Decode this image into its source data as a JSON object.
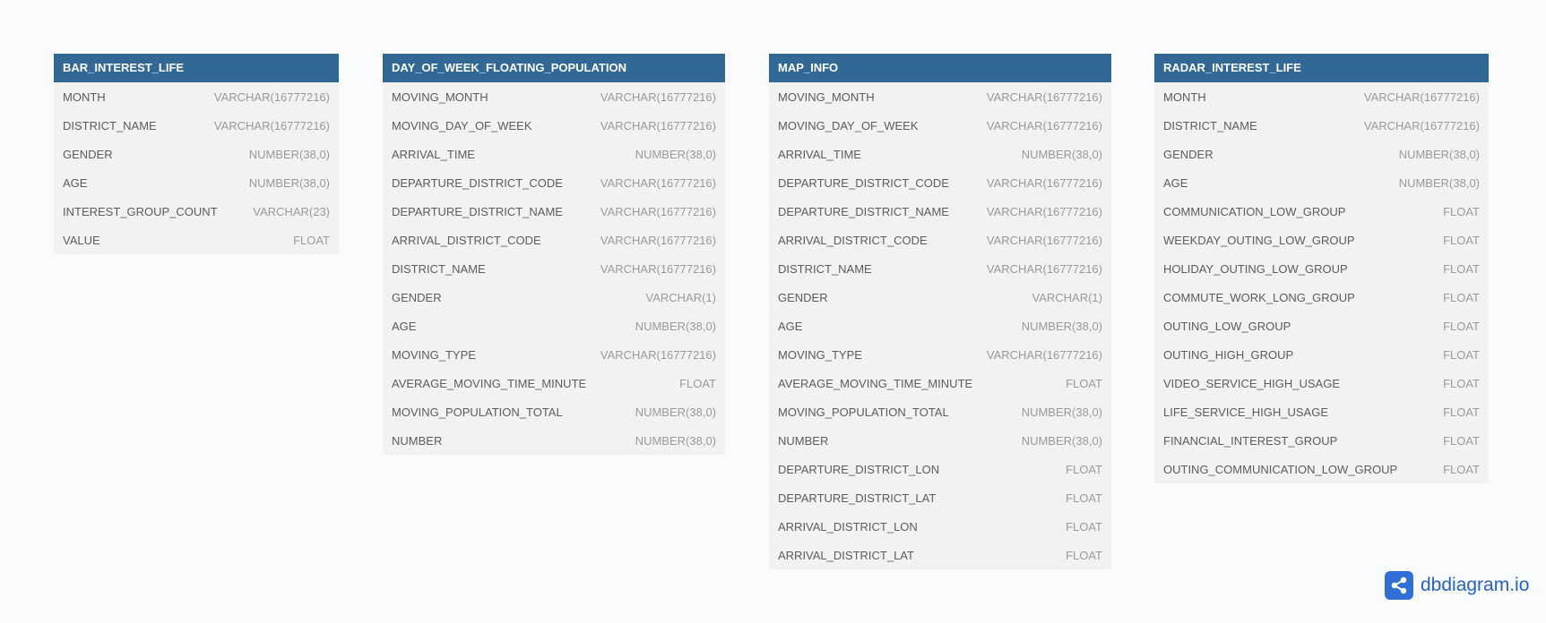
{
  "tables": [
    {
      "name": "BAR_INTEREST_LIFE",
      "fields": [
        {
          "name": "MONTH",
          "type": "VARCHAR(16777216)"
        },
        {
          "name": "DISTRICT_NAME",
          "type": "VARCHAR(16777216)"
        },
        {
          "name": "GENDER",
          "type": "NUMBER(38,0)"
        },
        {
          "name": "AGE",
          "type": "NUMBER(38,0)"
        },
        {
          "name": "INTEREST_GROUP_COUNT",
          "type": "VARCHAR(23)"
        },
        {
          "name": "VALUE",
          "type": "FLOAT"
        }
      ]
    },
    {
      "name": "DAY_OF_WEEK_FLOATING_POPULATION",
      "fields": [
        {
          "name": "MOVING_MONTH",
          "type": "VARCHAR(16777216)"
        },
        {
          "name": "MOVING_DAY_OF_WEEK",
          "type": "VARCHAR(16777216)"
        },
        {
          "name": "ARRIVAL_TIME",
          "type": "NUMBER(38,0)"
        },
        {
          "name": "DEPARTURE_DISTRICT_CODE",
          "type": "VARCHAR(16777216)"
        },
        {
          "name": "DEPARTURE_DISTRICT_NAME",
          "type": "VARCHAR(16777216)"
        },
        {
          "name": "ARRIVAL_DISTRICT_CODE",
          "type": "VARCHAR(16777216)"
        },
        {
          "name": "DISTRICT_NAME",
          "type": "VARCHAR(16777216)"
        },
        {
          "name": "GENDER",
          "type": "VARCHAR(1)"
        },
        {
          "name": "AGE",
          "type": "NUMBER(38,0)"
        },
        {
          "name": "MOVING_TYPE",
          "type": "VARCHAR(16777216)"
        },
        {
          "name": "AVERAGE_MOVING_TIME_MINUTE",
          "type": "FLOAT"
        },
        {
          "name": "MOVING_POPULATION_TOTAL",
          "type": "NUMBER(38,0)"
        },
        {
          "name": "NUMBER",
          "type": "NUMBER(38,0)"
        }
      ]
    },
    {
      "name": "MAP_INFO",
      "fields": [
        {
          "name": "MOVING_MONTH",
          "type": "VARCHAR(16777216)"
        },
        {
          "name": "MOVING_DAY_OF_WEEK",
          "type": "VARCHAR(16777216)"
        },
        {
          "name": "ARRIVAL_TIME",
          "type": "NUMBER(38,0)"
        },
        {
          "name": "DEPARTURE_DISTRICT_CODE",
          "type": "VARCHAR(16777216)"
        },
        {
          "name": "DEPARTURE_DISTRICT_NAME",
          "type": "VARCHAR(16777216)"
        },
        {
          "name": "ARRIVAL_DISTRICT_CODE",
          "type": "VARCHAR(16777216)"
        },
        {
          "name": "DISTRICT_NAME",
          "type": "VARCHAR(16777216)"
        },
        {
          "name": "GENDER",
          "type": "VARCHAR(1)"
        },
        {
          "name": "AGE",
          "type": "NUMBER(38,0)"
        },
        {
          "name": "MOVING_TYPE",
          "type": "VARCHAR(16777216)"
        },
        {
          "name": "AVERAGE_MOVING_TIME_MINUTE",
          "type": "FLOAT"
        },
        {
          "name": "MOVING_POPULATION_TOTAL",
          "type": "NUMBER(38,0)"
        },
        {
          "name": "NUMBER",
          "type": "NUMBER(38,0)"
        },
        {
          "name": "DEPARTURE_DISTRICT_LON",
          "type": "FLOAT"
        },
        {
          "name": "DEPARTURE_DISTRICT_LAT",
          "type": "FLOAT"
        },
        {
          "name": "ARRIVAL_DISTRICT_LON",
          "type": "FLOAT"
        },
        {
          "name": "ARRIVAL_DISTRICT_LAT",
          "type": "FLOAT"
        }
      ]
    },
    {
      "name": "RADAR_INTEREST_LIFE",
      "fields": [
        {
          "name": "MONTH",
          "type": "VARCHAR(16777216)"
        },
        {
          "name": "DISTRICT_NAME",
          "type": "VARCHAR(16777216)"
        },
        {
          "name": "GENDER",
          "type": "NUMBER(38,0)"
        },
        {
          "name": "AGE",
          "type": "NUMBER(38,0)"
        },
        {
          "name": "COMMUNICATION_LOW_GROUP",
          "type": "FLOAT"
        },
        {
          "name": "WEEKDAY_OUTING_LOW_GROUP",
          "type": "FLOAT"
        },
        {
          "name": "HOLIDAY_OUTING_LOW_GROUP",
          "type": "FLOAT"
        },
        {
          "name": "COMMUTE_WORK_LONG_GROUP",
          "type": "FLOAT"
        },
        {
          "name": "OUTING_LOW_GROUP",
          "type": "FLOAT"
        },
        {
          "name": "OUTING_HIGH_GROUP",
          "type": "FLOAT"
        },
        {
          "name": "VIDEO_SERVICE_HIGH_USAGE",
          "type": "FLOAT"
        },
        {
          "name": "LIFE_SERVICE_HIGH_USAGE",
          "type": "FLOAT"
        },
        {
          "name": "FINANCIAL_INTEREST_GROUP",
          "type": "FLOAT"
        },
        {
          "name": "OUTING_COMMUNICATION_LOW_GROUP",
          "type": "FLOAT"
        }
      ]
    }
  ],
  "brand": {
    "text": "dbdiagram.io",
    "icon": "share-nodes-icon",
    "color": "#2f6fd6"
  },
  "colors": {
    "header": "#316896",
    "body": "#f2f2f2",
    "background": "#fafbfc"
  }
}
